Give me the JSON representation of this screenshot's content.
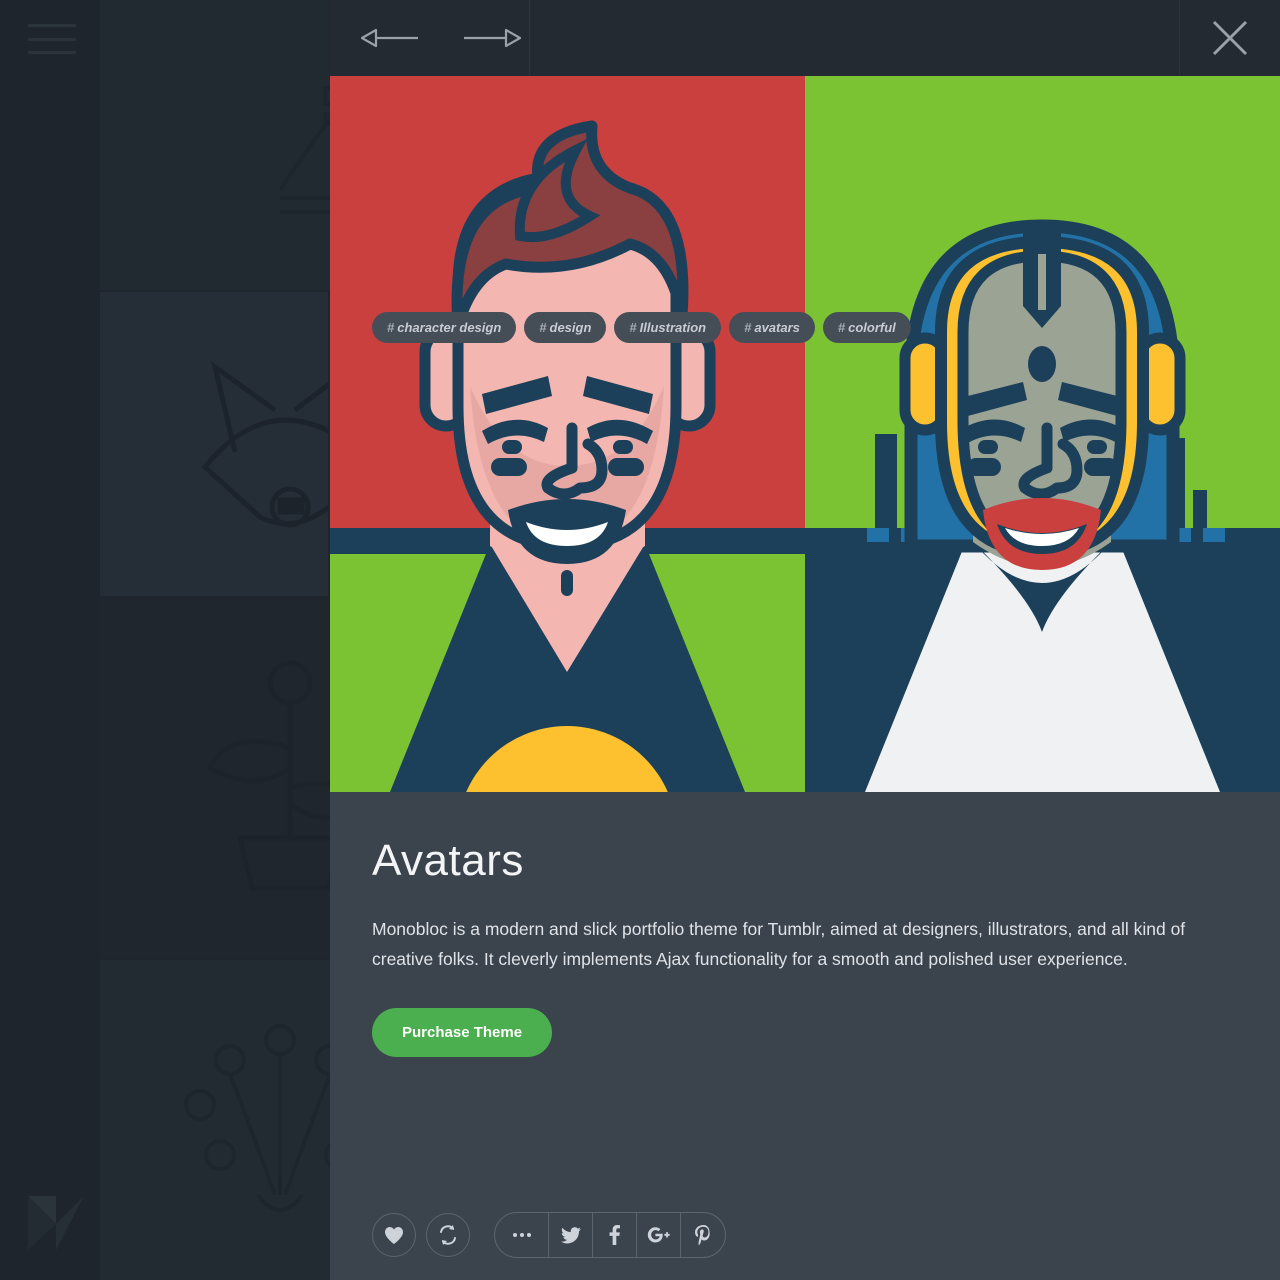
{
  "background": {
    "menu_icon": "hamburger-menu-icon",
    "logo_icon": "monobloc-m-logo",
    "thumbnails": [
      {
        "name": "brooklyn-bridge-illustration"
      },
      {
        "name": "fox-illustration"
      },
      {
        "name": "plant-illustration"
      },
      {
        "name": "peacock-illustration"
      }
    ]
  },
  "lightbox": {
    "header": {
      "prev_icon": "arrow-left-icon",
      "next_icon": "arrow-right-icon",
      "close_icon": "close-icon"
    },
    "media": {
      "alt": "Two flat-style character avatars",
      "items": [
        {
          "name": "avatar-male",
          "bg_top": "#C9403F",
          "bg_bottom": "#7CC334",
          "skin": "#F4B6B0",
          "hair": "#8A3F41",
          "outline": "#1C4059",
          "shirt": "#1C4059",
          "accent": "#FDC02F"
        },
        {
          "name": "avatar-female",
          "bg_top": "#7CC334",
          "bg_bottom": "#1C4059",
          "skin": "#9AA394",
          "hair": "#FDC02F",
          "outline": "#1C4059",
          "shirt": "#F0F1F2",
          "accent": "#2272A8"
        }
      ]
    },
    "title": "Avatars",
    "description": "Monobloc is a modern and slick portfolio theme for Tumblr, aimed at designers, illustrators, and all kind of creative folks. It cleverly implements Ajax functionality for a smooth and polished user experience.",
    "purchase_label": "Purchase Theme",
    "tags": [
      {
        "hash": "#",
        "label": "character design"
      },
      {
        "hash": "#",
        "label": "design"
      },
      {
        "hash": "#",
        "label": "Illustration"
      },
      {
        "hash": "#",
        "label": "avatars"
      },
      {
        "hash": "#",
        "label": "colorful"
      }
    ],
    "actions": {
      "like_icon": "heart-icon",
      "reblog_icon": "reblog-icon",
      "more_icon": "ellipsis-icon",
      "twitter_icon": "twitter-icon",
      "facebook_label": "f",
      "googleplus_label": "G",
      "pinterest_label": "P"
    },
    "colors": {
      "panel": "#3b434c",
      "header": "#232a32",
      "accent_green": "#4BAE4F",
      "backdrop": "#1e252c"
    }
  }
}
